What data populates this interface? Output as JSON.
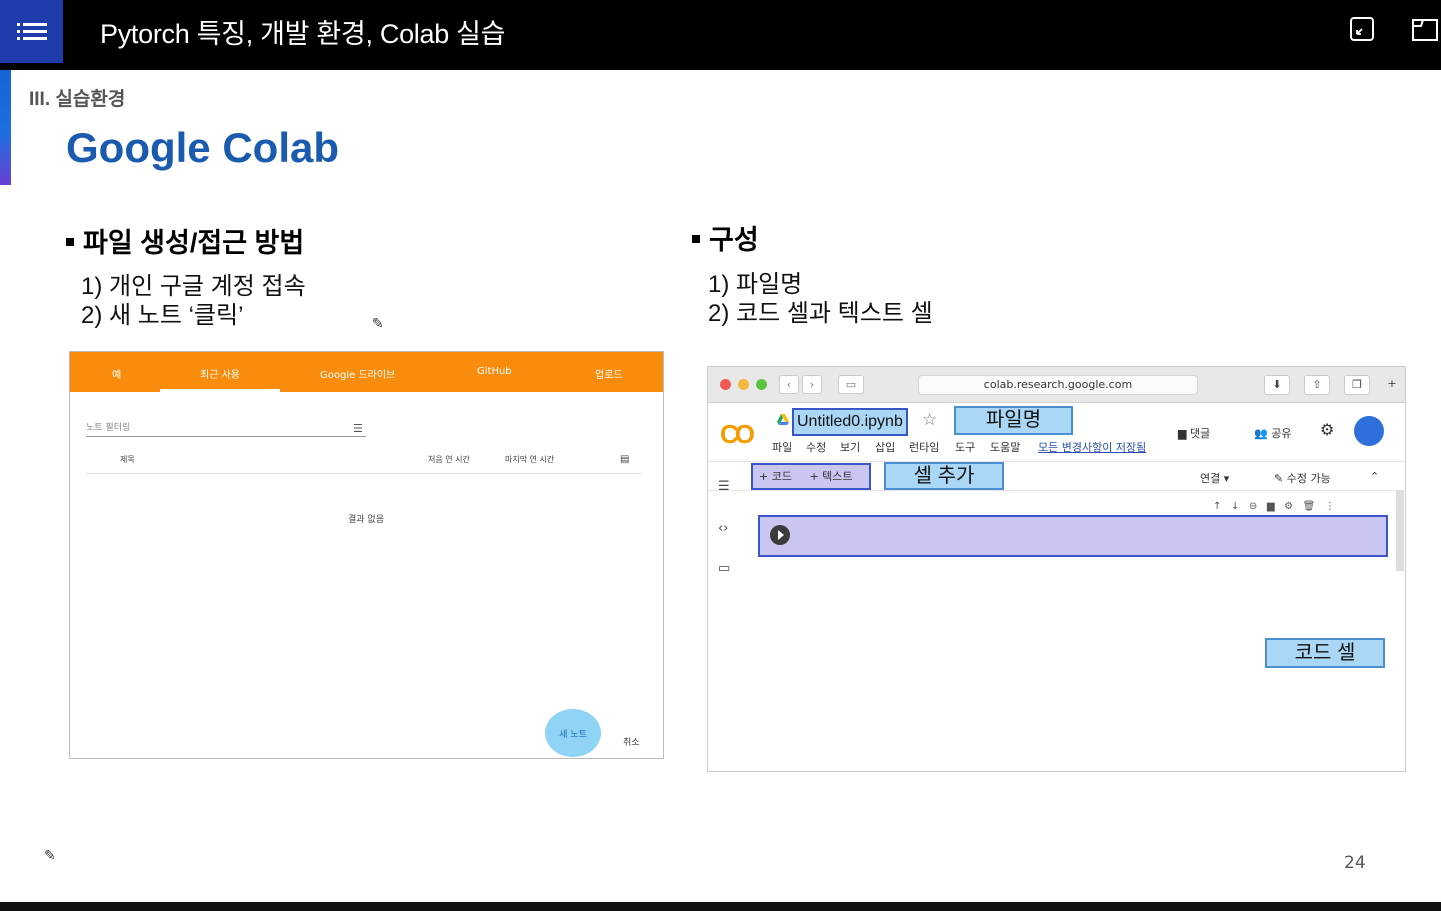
{
  "header": {
    "title": "Pytorch 특징, 개발 환경, Colab 실습",
    "menu_icon": "list-icon",
    "actions": [
      "fullscreen-icon",
      "open-external-icon"
    ]
  },
  "slide": {
    "section": "III. 실습환경",
    "title": "Google Colab",
    "left": {
      "heading": "파일 생성/접근 방법",
      "steps": [
        "1) 개인 구글 계정 접속",
        "2) 새 노트 ‘클릭’"
      ]
    },
    "right": {
      "heading": "구성",
      "steps": [
        "1) 파일명",
        "2) 코드 셀과 텍스트 셀"
      ]
    },
    "page_number": "24",
    "accent_color": "#1565d8",
    "title_color": "#1a5bb0"
  },
  "dialog": {
    "tabs": [
      "예",
      "최근 사용",
      "Google 드라이브",
      "GitHub",
      "업로드"
    ],
    "active_tab": "최근 사용",
    "filter_placeholder": "노트 필터링",
    "columns": [
      "제목",
      "처음 연 시간",
      "마지막 연 시간"
    ],
    "empty_text": "결과 없음",
    "new_note": "새 노트",
    "cancel": "취소",
    "tab_color": "#f98c0c"
  },
  "colab": {
    "url": "colab.research.google.com",
    "logo": "CO",
    "filename": "Untitled0.ipynb",
    "menu": [
      "파일",
      "수정",
      "보기",
      "삽입",
      "런타임",
      "도구",
      "도움말"
    ],
    "saved_status": "모든 변경사항이 저장됨",
    "comment": "댓글",
    "share": "공유",
    "add_code": "+ 코드",
    "add_text": "+ 텍스트",
    "connect": "연결",
    "editable": "수정 가능",
    "callouts": {
      "filename": "파일명",
      "add_cell": "셀 추가",
      "code_cell": "코드 셀"
    }
  }
}
